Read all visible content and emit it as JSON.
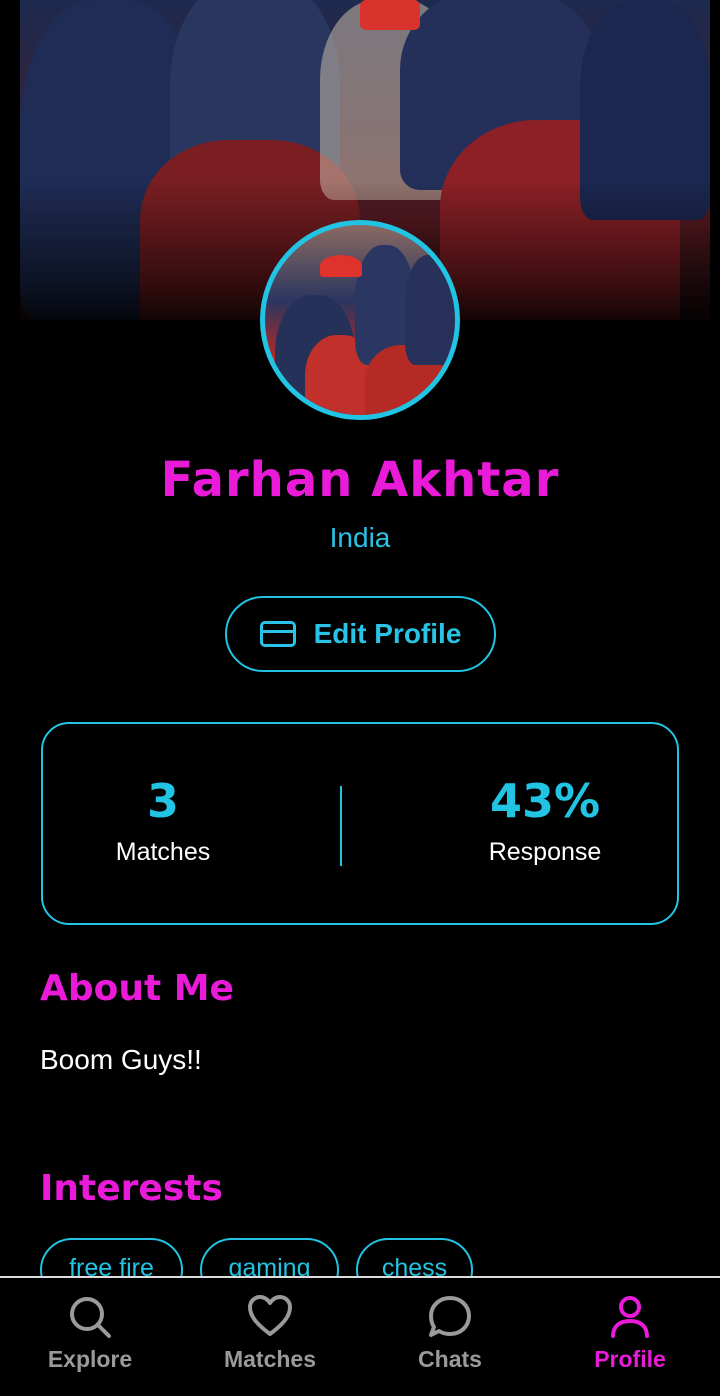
{
  "profile": {
    "name": "Farhan Akhtar",
    "country": "India",
    "edit_label": "Edit Profile"
  },
  "stats": {
    "matches_value": "3",
    "matches_label": "Matches",
    "response_value": "43%",
    "response_label": "Response"
  },
  "about": {
    "title": "About Me",
    "text": "Boom Guys!!"
  },
  "interests": {
    "title": "Interests",
    "items": [
      "free fire",
      "gaming",
      "chess"
    ]
  },
  "nav": {
    "items": [
      {
        "label": "Explore",
        "icon": "search-icon"
      },
      {
        "label": "Matches",
        "icon": "heart-icon"
      },
      {
        "label": "Chats",
        "icon": "chat-bubble-icon"
      },
      {
        "label": "Profile",
        "icon": "user-icon"
      }
    ],
    "active": "Profile"
  },
  "colors": {
    "accent_pink": "#e91bd9",
    "accent_cyan": "#22c4e4",
    "inactive": "#9a9a9a",
    "background": "#000000"
  }
}
